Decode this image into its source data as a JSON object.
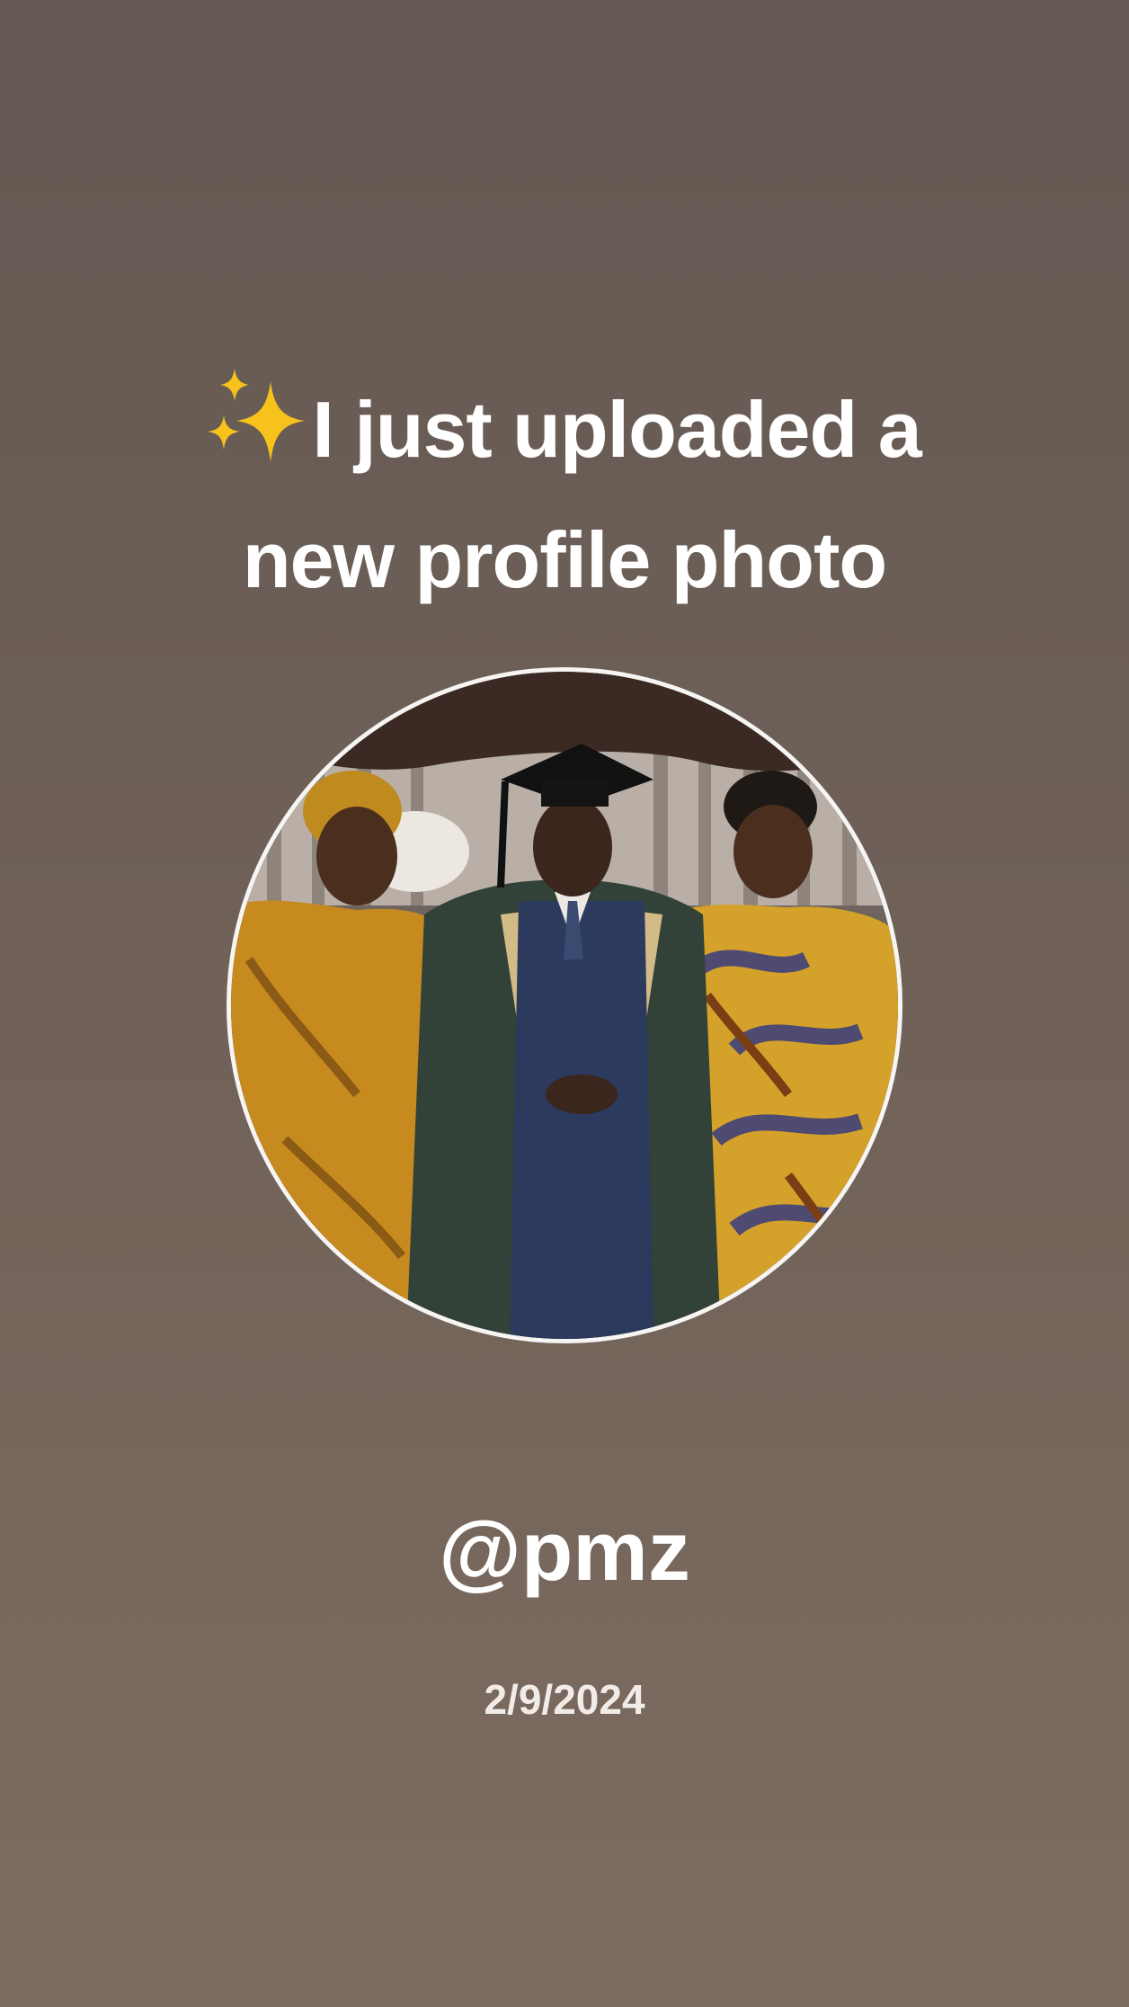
{
  "story": {
    "headline_line1": "I just uploaded a",
    "headline_line2": "new profile photo",
    "headline_icon": "sparkles-icon",
    "handle": "@pmz",
    "date": "2/9/2024"
  },
  "photo": {
    "icon": "profile-photo"
  },
  "colors": {
    "background_top": "#635852",
    "background_bottom": "#7c6b60",
    "text": "#ffffff",
    "sparkle": "#f6c21b"
  }
}
